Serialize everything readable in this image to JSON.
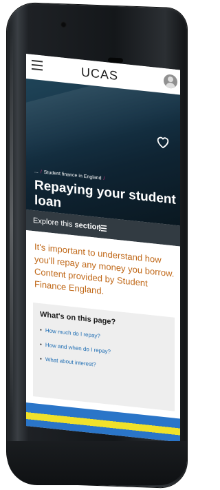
{
  "header": {
    "logo_text": "UCAS",
    "menu_icon": "hamburger-icon",
    "account_icon": "user-avatar-icon"
  },
  "hero": {
    "breadcrumb_ellipsis": "...",
    "breadcrumb_current": "Student finance in England",
    "title": "Repaying your student loan",
    "favourite_icon": "heart-icon"
  },
  "explore": {
    "label_prefix": "Explore this",
    "label_bold": "section",
    "icon": "list-icon"
  },
  "intro": {
    "text": "It's important to understand how you'll repay any money you borrow. Content provided by Student Finance England."
  },
  "on_this_page": {
    "heading": "What's on this page?",
    "links": [
      "How much do I repay?",
      "How and when do I repay?",
      "What about interest?"
    ]
  },
  "colors": {
    "accent_orange": "#c06818",
    "link_blue": "#1e6db3",
    "breadcrumb_pink": "#d12e7a",
    "hero_dark": "#0f2433"
  }
}
